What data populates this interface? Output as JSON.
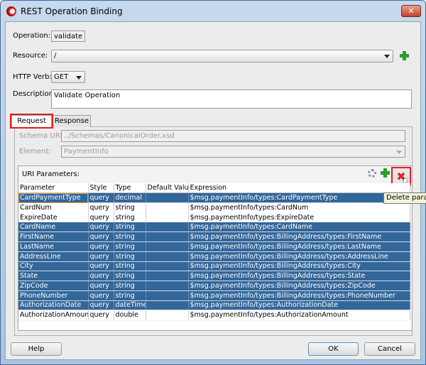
{
  "window": {
    "title": "REST Operation Binding",
    "close": "✕"
  },
  "form": {
    "operation_label": "Operation:",
    "operation_value": "validate",
    "resource_label": "Resource:",
    "resource_value": "/",
    "verb_label": "HTTP Verb:",
    "verb_value": "GET",
    "description_label": "Description:",
    "description_value": "Validate Operation"
  },
  "tabs": [
    {
      "label": "Request",
      "active": true
    },
    {
      "label": "Response",
      "active": false
    }
  ],
  "request": {
    "schema_label": "Schema URL:",
    "schema_value": "../Schemas/CanonicalOrder.xsd",
    "element_label": "Element:",
    "element_value": "PaymentInfo"
  },
  "uri_params": {
    "title": "URI Parameters:",
    "tooltip": "Delete param",
    "columns": [
      "Parameter",
      "Style",
      "Type",
      "Default Value",
      "Expression"
    ],
    "rows": [
      {
        "selected": true,
        "cells": [
          "CardPaymentType",
          "query",
          "decimal",
          "",
          "$msg.paymentInfo/types:CardPaymentType"
        ]
      },
      {
        "selected": false,
        "cells": [
          "CardNum",
          "query",
          "string",
          "",
          "$msg.paymentInfo/types:CardNum"
        ]
      },
      {
        "selected": false,
        "cells": [
          "ExpireDate",
          "query",
          "string",
          "",
          "$msg.paymentInfo/types:ExpireDate"
        ]
      },
      {
        "selected": true,
        "cells": [
          "CardName",
          "query",
          "string",
          "",
          "$msg.paymentInfo/types:CardName"
        ]
      },
      {
        "selected": true,
        "cells": [
          "FirstName",
          "query",
          "string",
          "",
          "$msg.paymentInfo/types:BillingAddress/types:FirstName"
        ]
      },
      {
        "selected": true,
        "cells": [
          "LastName",
          "query",
          "string",
          "",
          "$msg.paymentInfo/types:BillingAddress/types:LastName"
        ]
      },
      {
        "selected": true,
        "cells": [
          "AddressLine",
          "query",
          "string",
          "",
          "$msg.paymentInfo/types:BillingAddress/types:AddressLine"
        ]
      },
      {
        "selected": true,
        "cells": [
          "City",
          "query",
          "string",
          "",
          "$msg.paymentInfo/types:BillingAddress/types:City"
        ]
      },
      {
        "selected": true,
        "cells": [
          "State",
          "query",
          "string",
          "",
          "$msg.paymentInfo/types:BillingAddress/types:State"
        ]
      },
      {
        "selected": true,
        "cells": [
          "ZipCode",
          "query",
          "string",
          "",
          "$msg.paymentInfo/types:BillingAddress/types:ZipCode"
        ]
      },
      {
        "selected": true,
        "cells": [
          "PhoneNumber",
          "query",
          "string",
          "",
          "$msg.paymentInfo/types:BillingAddress/types:PhoneNumber"
        ]
      },
      {
        "selected": true,
        "cells": [
          "AuthorizationDate",
          "query",
          "dateTime",
          "",
          "$msg.paymentInfo/types:AuthorizationDate"
        ]
      },
      {
        "selected": false,
        "cells": [
          "AuthorizationAmount",
          "query",
          "double",
          "",
          "$msg.paymentInfo/types:AuthorizationAmount"
        ]
      }
    ]
  },
  "buttons": {
    "help": "Help",
    "ok": "OK",
    "cancel": "Cancel"
  },
  "colors": {
    "selection": "#336699",
    "highlight": "#e02020"
  }
}
